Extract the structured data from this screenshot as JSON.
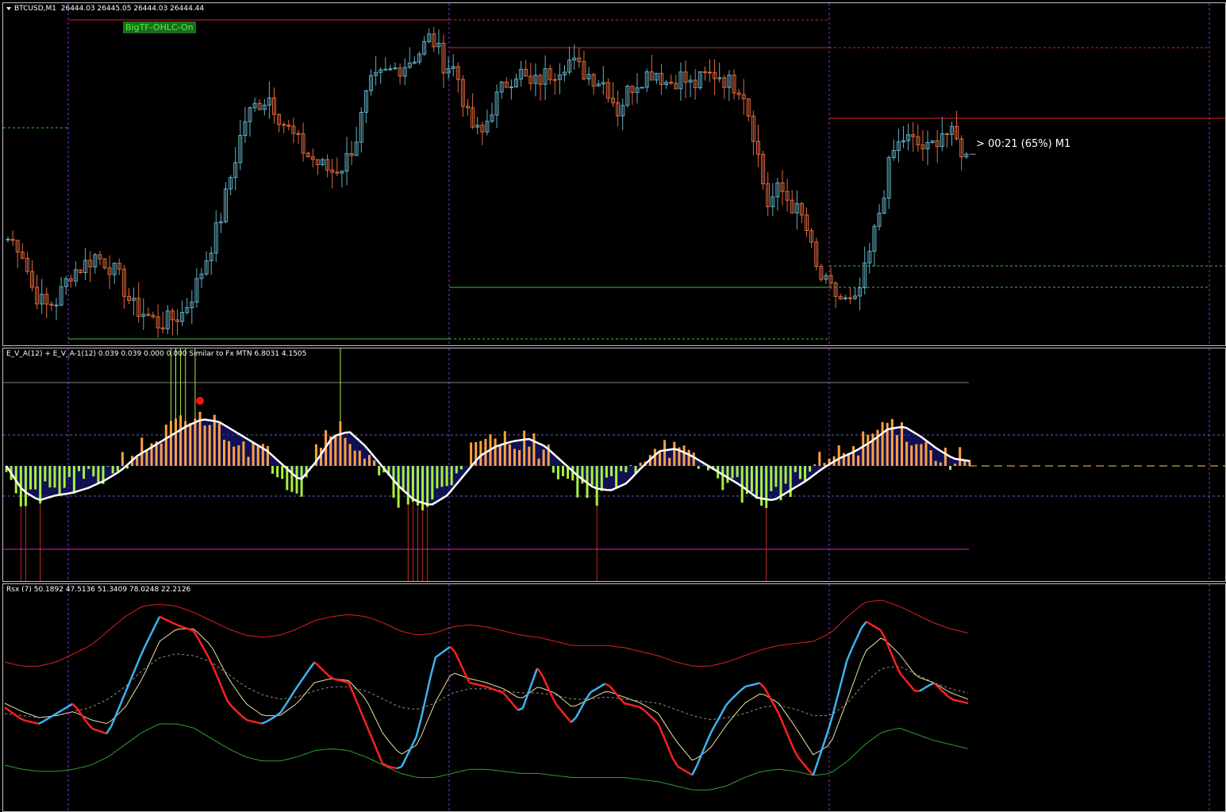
{
  "header": {
    "symbol": "BTCUSD,M1",
    "ohlc": "26444.03 26445.05 26444.03 26444.44"
  },
  "badge": "BigTF-OHLC-On",
  "timer": "> 00:21 (65%) M1",
  "indicator_label": "E_V_A(12) + E_V_A-1(12) 0.039 0.039 0.000 0.000   Similar to Fx MTN  6.8031 4.1505",
  "rsx_label": "Rsx (7) 50.1892 47.5136 51.3409 78.0248 22.2126",
  "colors": {
    "bull": "#5fb0c4",
    "bear": "#e06a3c",
    "resistance": "#e0202a",
    "support": "#3cc43c",
    "separator": "#8a2be2",
    "eva_pos": "#ffa040",
    "eva_neg": "#a6f03c",
    "eva_line": "#ffffff",
    "rsx_up": "#3cb4f0",
    "rsx_down": "#ff2020",
    "band_upper": "#e02020",
    "band_lower": "#30a030"
  },
  "chart_data": [
    {
      "type": "candlestick",
      "title": "BTCUSD,M1",
      "series": [
        {
          "name": "BTCUSD",
          "close_path": [
            26420,
            26418,
            26405,
            26400,
            26402,
            26410,
            26412,
            26415,
            26413,
            26408,
            26400,
            26398,
            26395,
            26396,
            26398,
            26405,
            26415,
            26425,
            26440,
            26455,
            26460,
            26462,
            26455,
            26450,
            26445,
            26442,
            26440,
            26442,
            26450,
            26465,
            26468,
            26470,
            26472,
            26475,
            26480,
            26472,
            26470,
            26455,
            26450,
            26460,
            26466,
            26470,
            26465,
            26468,
            26470,
            26473,
            26470,
            26468,
            26466,
            26458,
            26465,
            26468,
            26470,
            26466,
            26468,
            26465,
            26468,
            26469,
            26466,
            26465,
            26450,
            26430,
            26435,
            26430,
            26425,
            26410,
            26405,
            26402,
            26400,
            26412,
            26428,
            26445,
            26450,
            26448,
            26446,
            26452,
            26450,
            26444
          ]
        }
      ],
      "current_price": 26444.44,
      "resistance_levels": 3,
      "support_levels": 3
    },
    {
      "type": "bar",
      "title": "E_V_A(12) + E_V_A-1(12)",
      "series": [
        {
          "name": "E_V_A",
          "values": [
            0.1,
            -0.8,
            -0.6,
            -0.5,
            -0.4,
            -0.3,
            -0.2,
            0.1,
            0.3,
            0.5,
            0.7,
            0.9,
            1.0,
            0.8,
            0.6,
            0.4,
            0.2,
            -0.2,
            -0.5,
            0.4,
            0.9,
            0.6,
            0.2,
            -0.3,
            -0.6,
            -0.9,
            -0.7,
            -0.4,
            0.2,
            0.4,
            0.5,
            0.6,
            0.5,
            0.3,
            -0.2,
            -0.4,
            -0.6,
            -0.4,
            -0.2,
            0.2,
            0.5,
            0.3,
            0.1,
            -0.1,
            -0.3,
            -0.5,
            -0.8,
            -0.6,
            -0.4,
            -0.2,
            0.1,
            0.2,
            0.4,
            0.6,
            0.9,
            0.7,
            0.5,
            0.2,
            0.1,
            0.2
          ]
        },
        {
          "name": "E_V_A-1",
          "values": [
            0.0,
            -0.5,
            -0.7,
            -0.6,
            -0.55,
            -0.45,
            -0.3,
            -0.1,
            0.2,
            0.4,
            0.6,
            0.8,
            0.95,
            0.9,
            0.7,
            0.5,
            0.3,
            0.0,
            -0.3,
            0.1,
            0.6,
            0.7,
            0.4,
            0.0,
            -0.4,
            -0.7,
            -0.8,
            -0.6,
            -0.2,
            0.2,
            0.4,
            0.5,
            0.55,
            0.4,
            0.1,
            -0.2,
            -0.45,
            -0.5,
            -0.35,
            0.0,
            0.3,
            0.35,
            0.2,
            0.0,
            -0.2,
            -0.4,
            -0.65,
            -0.7,
            -0.5,
            -0.3,
            -0.05,
            0.15,
            0.3,
            0.5,
            0.75,
            0.8,
            0.6,
            0.35,
            0.15,
            0.1
          ]
        }
      ],
      "levels": [
        1.2,
        0.5,
        0,
        -0.5,
        -1.3
      ]
    },
    {
      "type": "line",
      "title": "Rsx (7)",
      "series": [
        {
          "name": "Rsx",
          "values": [
            48,
            42,
            40,
            45,
            50,
            38,
            35,
            55,
            75,
            92,
            88,
            85,
            70,
            50,
            42,
            40,
            45,
            58,
            70,
            62,
            60,
            40,
            20,
            18,
            35,
            72,
            78,
            60,
            58,
            55,
            45,
            68,
            50,
            40,
            55,
            60,
            50,
            48,
            40,
            20,
            15,
            35,
            50,
            58,
            60,
            45,
            25,
            15,
            40,
            72,
            90,
            85,
            65,
            55,
            60,
            52,
            50
          ]
        },
        {
          "name": "Signal",
          "values": [
            50,
            46,
            43,
            44,
            46,
            42,
            40,
            48,
            62,
            80,
            86,
            86,
            78,
            62,
            50,
            44,
            44,
            50,
            60,
            62,
            61,
            52,
            35,
            25,
            30,
            50,
            65,
            62,
            60,
            57,
            52,
            58,
            55,
            48,
            52,
            56,
            53,
            50,
            45,
            32,
            22,
            28,
            40,
            50,
            55,
            50,
            38,
            25,
            30,
            52,
            75,
            82,
            74,
            63,
            60,
            55,
            52
          ]
        },
        {
          "name": "Average",
          "values": [
            45,
            44,
            43,
            44,
            46,
            48,
            52,
            58,
            66,
            72,
            74,
            73,
            70,
            64,
            58,
            54,
            52,
            53,
            56,
            58,
            58,
            56,
            52,
            48,
            47,
            50,
            55,
            57,
            57,
            56,
            55,
            55,
            54,
            52,
            52,
            53,
            52,
            51,
            50,
            47,
            44,
            42,
            43,
            45,
            48,
            49,
            47,
            44,
            44,
            50,
            60,
            67,
            68,
            64,
            60,
            57,
            55
          ]
        },
        {
          "name": "Upper",
          "values": [
            70,
            68,
            68,
            70,
            74,
            78,
            85,
            92,
            97,
            98,
            97,
            94,
            90,
            86,
            83,
            82,
            83,
            86,
            90,
            92,
            93,
            92,
            89,
            85,
            83,
            84,
            87,
            88,
            87,
            85,
            83,
            82,
            80,
            78,
            78,
            78,
            77,
            75,
            73,
            70,
            68,
            68,
            70,
            73,
            76,
            78,
            79,
            80,
            84,
            92,
            99,
            100,
            97,
            93,
            89,
            86,
            84
          ]
        },
        {
          "name": "Lower",
          "values": [
            20,
            18,
            17,
            17,
            18,
            20,
            24,
            30,
            36,
            40,
            40,
            38,
            33,
            28,
            24,
            22,
            22,
            24,
            27,
            28,
            27,
            24,
            20,
            16,
            14,
            14,
            16,
            18,
            18,
            17,
            16,
            16,
            15,
            14,
            14,
            14,
            14,
            13,
            12,
            10,
            8,
            8,
            10,
            14,
            17,
            18,
            17,
            15,
            16,
            22,
            30,
            36,
            38,
            35,
            32,
            30,
            28
          ]
        }
      ],
      "ylim": [
        0,
        100
      ]
    }
  ]
}
